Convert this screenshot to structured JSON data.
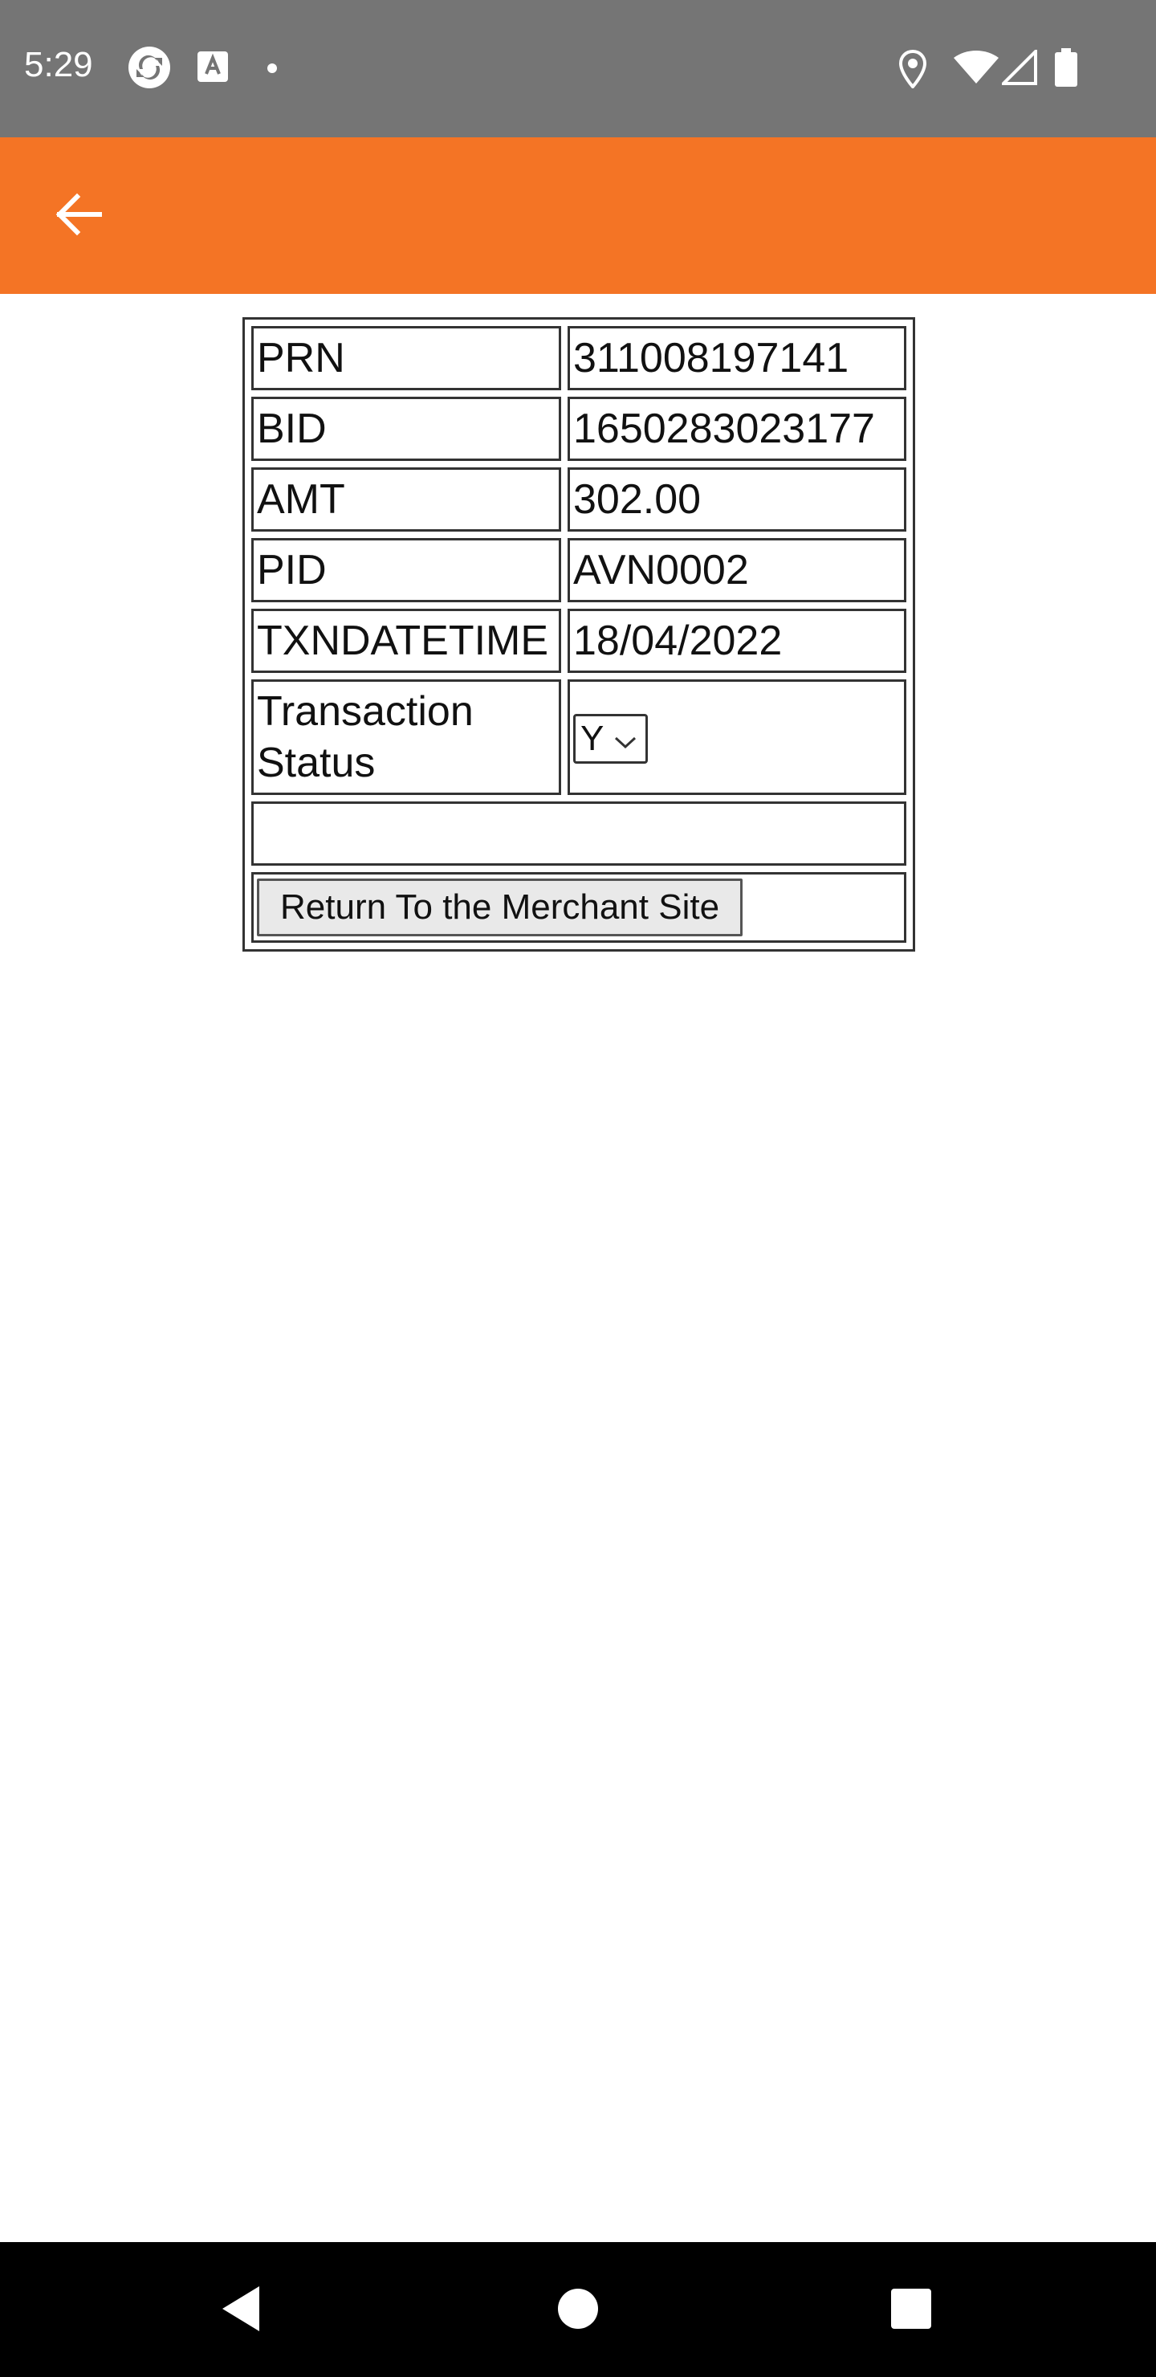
{
  "status_bar": {
    "time": "5:29",
    "left_icons": [
      "sync-icon",
      "text-badge-icon",
      "dot-icon"
    ],
    "right_icons": [
      "location-icon",
      "wifi-icon",
      "signal-icon",
      "battery-icon"
    ],
    "color": "#757575"
  },
  "app_bar": {
    "color": "#f47425",
    "back_icon": "arrow-left-icon"
  },
  "transaction": {
    "rows": [
      {
        "label": "PRN",
        "value": "311008197141"
      },
      {
        "label": "BID",
        "value": "1650283023177"
      },
      {
        "label": "AMT",
        "value": "302.00"
      },
      {
        "label": "PID",
        "value": "AVN0002"
      },
      {
        "label": "TXNDATETIME",
        "value": "18/04/2022"
      }
    ],
    "status_label": "Transaction Status",
    "status_selected": "Y",
    "return_button": "Return To the Merchant Site"
  },
  "nav_bar": {
    "icons": [
      "back-triangle-icon",
      "home-circle-icon",
      "recents-square-icon"
    ]
  }
}
